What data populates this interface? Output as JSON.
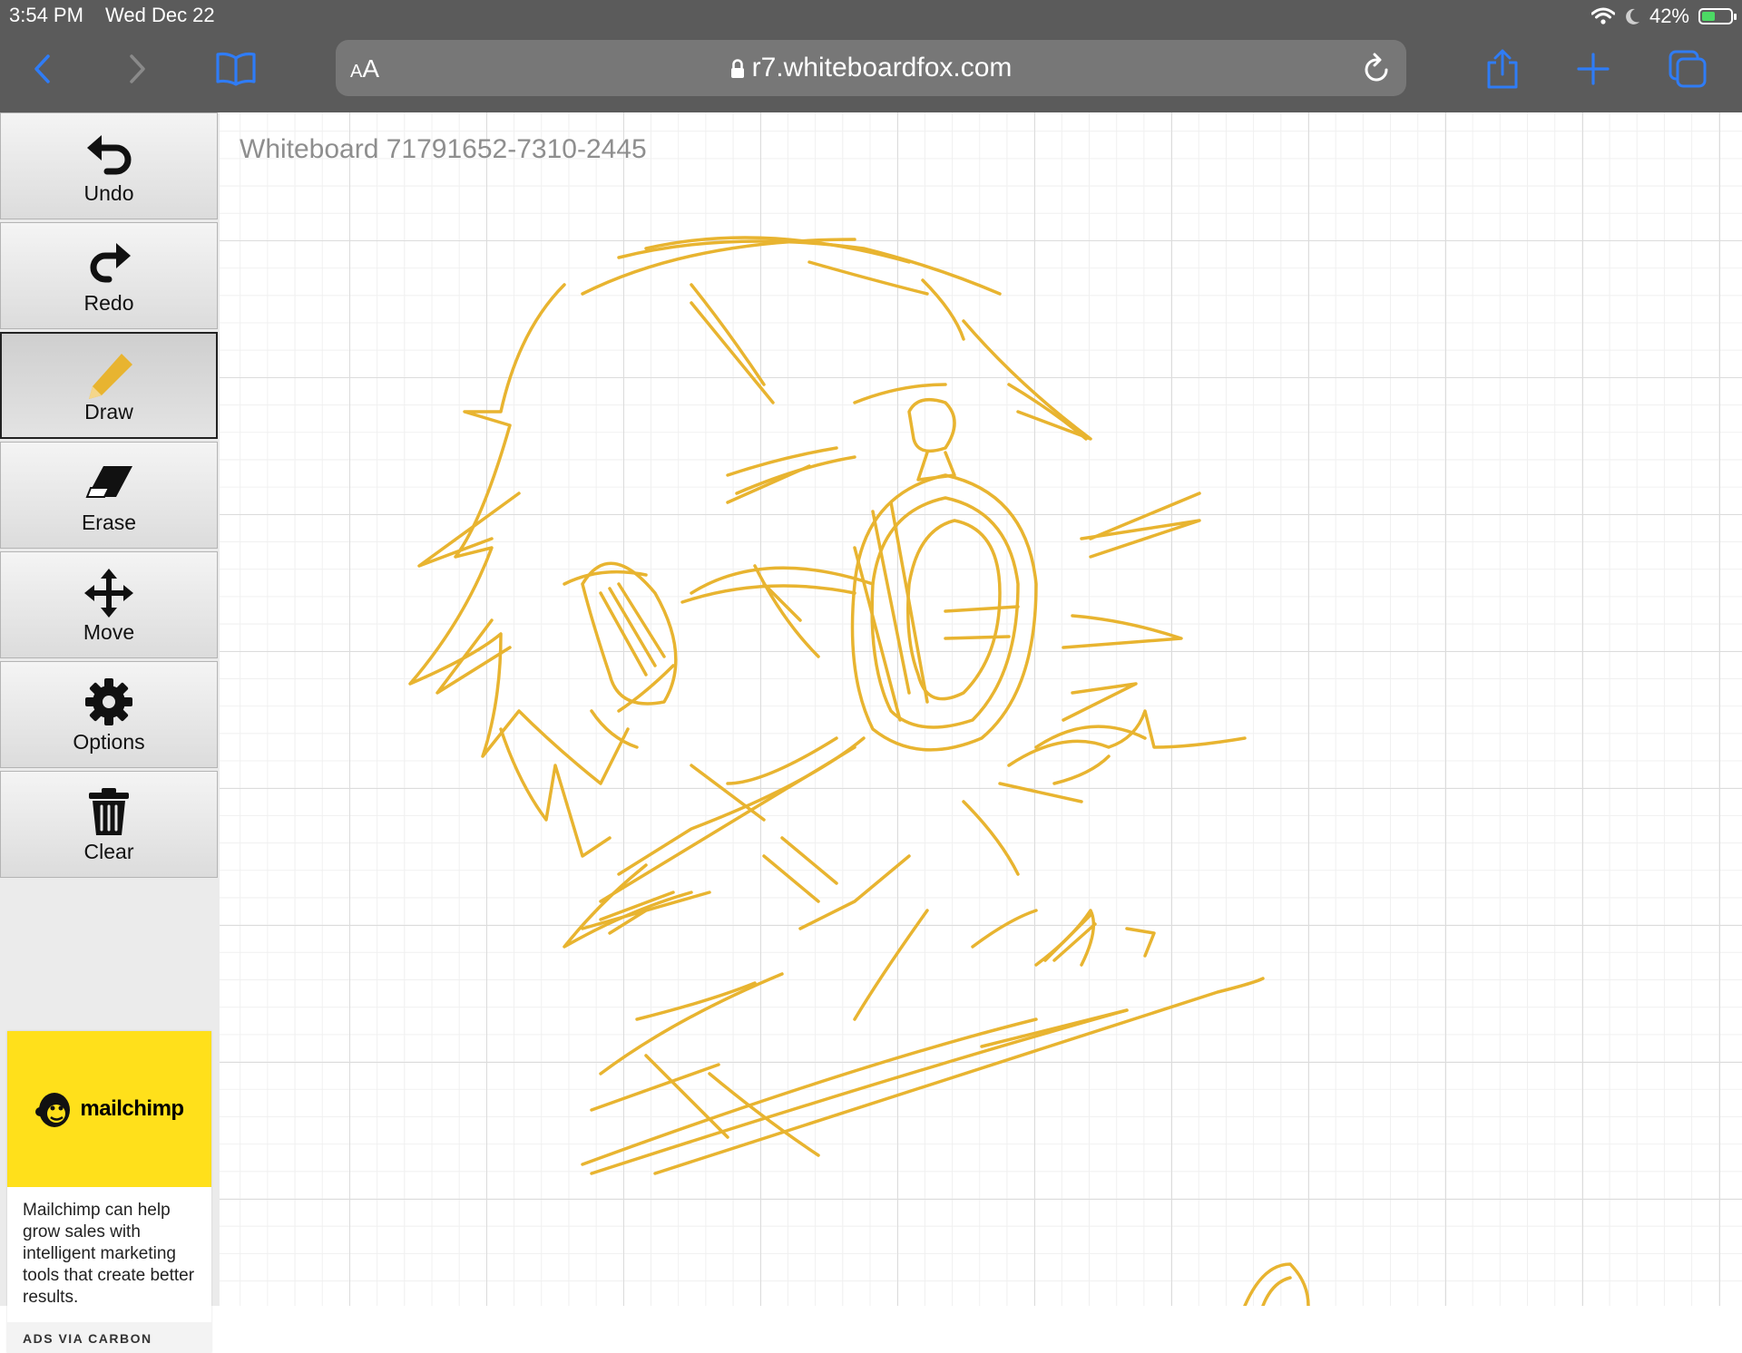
{
  "status_bar": {
    "time": "3:54 PM",
    "date": "Wed Dec 22",
    "battery": "42%",
    "battery_level": 0.42,
    "battery_color": "#4cd964"
  },
  "safari": {
    "text_size_button": "AA",
    "url": "r7.whiteboardfox.com",
    "icons": [
      "back-icon",
      "forward-icon",
      "bookmarks-icon",
      "lock-icon",
      "reload-icon",
      "share-icon",
      "new-tab-icon",
      "tabs-icon"
    ],
    "accent_color": "#2f7cf6"
  },
  "toolbar": {
    "tools": [
      {
        "label": "Undo",
        "icon": "undo-icon"
      },
      {
        "label": "Redo",
        "icon": "redo-icon"
      },
      {
        "label": "Draw",
        "icon": "pencil-icon",
        "active": true
      },
      {
        "label": "Erase",
        "icon": "eraser-icon"
      },
      {
        "label": "Move",
        "icon": "move-icon"
      },
      {
        "label": "Options",
        "icon": "gear-icon"
      },
      {
        "label": "Clear",
        "icon": "trash-icon"
      }
    ]
  },
  "ad": {
    "brand": "mailchimp",
    "brand_color": "#ffe01b",
    "text": "Mailchimp can help grow sales with intelligent marketing tools that create better results.",
    "footer": "ADS VIA CARBON"
  },
  "board": {
    "title": "Whiteboard 71791652-7310-2445",
    "stroke_color": "#e8b430"
  }
}
